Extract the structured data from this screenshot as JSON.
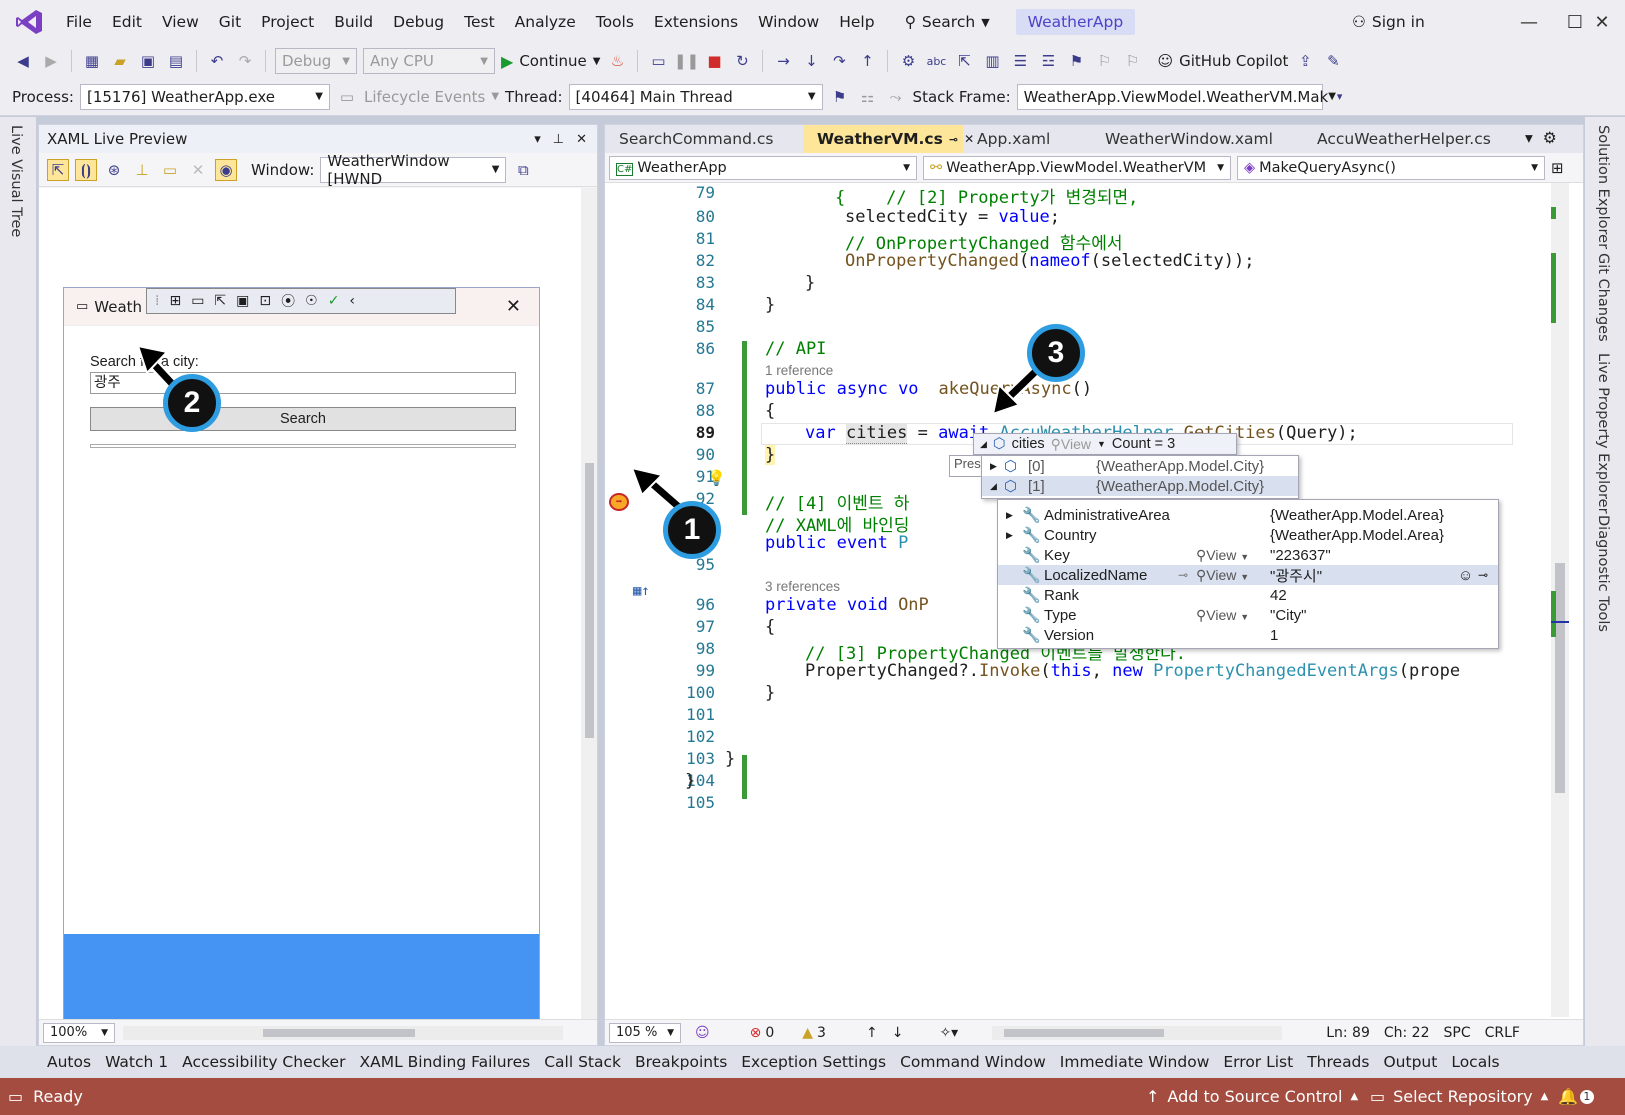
{
  "menu": [
    "File",
    "Edit",
    "View",
    "Git",
    "Project",
    "Build",
    "Debug",
    "Test",
    "Analyze",
    "Tools",
    "Extensions",
    "Window",
    "Help"
  ],
  "search_label": "Search",
  "solution_name": "WeatherApp",
  "sign_in": "Sign in",
  "toolbar": {
    "config": "Debug",
    "platform": "Any CPU",
    "continue_label": "Continue",
    "copilot": "GitHub Copilot"
  },
  "debugbar": {
    "process_label": "Process:",
    "process_value": "[15176] WeatherApp.exe",
    "lifecycle": "Lifecycle Events",
    "thread_label": "Thread:",
    "thread_value": "[40464] Main Thread",
    "stackframe_label": "Stack Frame:",
    "stackframe_value": "WeatherApp.ViewModel.WeatherVM.Mak"
  },
  "left_strip": "Live Visual Tree",
  "xaml": {
    "title": "XAML Live Preview",
    "window_label": "Window:",
    "window_value": "WeatherWindow [HWND",
    "zoom": "100%",
    "wpf_title": "Weath",
    "search_prompt": "Search for a city:",
    "search_value": "광주",
    "search_button": "Search"
  },
  "tabs": [
    "SearchCommand.cs",
    "WeatherVM.cs",
    "App.xaml",
    "WeatherWindow.xaml",
    "AccuWeatherHelper.cs"
  ],
  "nav": {
    "project": "WeatherApp",
    "class": "WeatherApp.ViewModel.WeatherVM",
    "member": "MakeQueryAsync()"
  },
  "code": {
    "line_numbers": [
      "79",
      "80",
      "81",
      "82",
      "83",
      "84",
      "85",
      "86",
      "87",
      "88",
      "89",
      "90",
      "91",
      "92",
      "93",
      "94",
      "95",
      "96",
      "97",
      "98",
      "99",
      "100",
      "101",
      "102",
      "103",
      "104",
      "105"
    ],
    "l79": "{    // [2] Property가 변경되면,",
    "l80a": "selectedCity = ",
    "l80b": "value",
    "l80c": ";",
    "l81": "// OnPropertyChanged 함수에서",
    "l82a": "OnPropertyChanged",
    "l82b": "(",
    "l82c": "nameof",
    "l82d": "(selectedCity));",
    "l83": "}",
    "l84": "}",
    "l86": "// API",
    "ref1": "1 reference",
    "l87a": "public async ",
    "l87b": "vo",
    "l87c": "akeQueryAsync",
    "l87d": "()",
    "l88": "{",
    "l89a": "var ",
    "l89b": "cities",
    "l89c": " = ",
    "l89d": "await ",
    "l89e": "AccuWeatherHelper",
    "l89f": ".",
    "l89g": "GetCities",
    "l89h": "(Query);",
    "l90": "}",
    "l92": "// [4] 이벤트 하",
    "l93": "// XAML에 바인딩",
    "l93end": ".",
    "l94a": "public event ",
    "l94b": "P",
    "ref3": "3 references",
    "l96a": "private void ",
    "l96b": "OnP",
    "l97": "{",
    "l98": "// [3] PropertyChanged 이벤트를 발생한다.",
    "l99a": "PropertyChanged?.",
    "l99b": "Invoke",
    "l99c": "(",
    "l99d": "this",
    "l99e": ", ",
    "l99f": "new ",
    "l99g": "PropertyChangedEventArgs",
    "l99h": "(prope",
    "l100": "}",
    "l103": "}",
    "l104": "}"
  },
  "datatip": {
    "var": "cities",
    "view": "View",
    "count": "Count = 3",
    "press": "Pres",
    "items": [
      {
        "index": "[0]",
        "value": "{WeatherApp.Model.City}"
      },
      {
        "index": "[1]",
        "value": "{WeatherApp.Model.City}"
      }
    ],
    "props": [
      {
        "name": "AdministrativeArea",
        "value": "{WeatherApp.Model.Area}",
        "view": ""
      },
      {
        "name": "Country",
        "value": "{WeatherApp.Model.Area}",
        "view": ""
      },
      {
        "name": "Key",
        "value": "\"223637\"",
        "view": "View"
      },
      {
        "name": "LocalizedName",
        "value": "\"광주시\"",
        "view": "View"
      },
      {
        "name": "Rank",
        "value": "42",
        "view": ""
      },
      {
        "name": "Type",
        "value": "\"City\"",
        "view": "View"
      },
      {
        "name": "Version",
        "value": "1",
        "view": ""
      }
    ]
  },
  "editor_status": {
    "zoom": "105 %",
    "errors": "0",
    "warnings": "3",
    "ln": "Ln: 89",
    "ch": "Ch: 22",
    "spc": "SPC",
    "crlf": "CRLF"
  },
  "right_strip": [
    "Solution Explorer",
    "Git Changes",
    "Live Property Explorer",
    "Diagnostic Tools"
  ],
  "bottom_tabs": [
    "Autos",
    "Watch 1",
    "Accessibility Checker",
    "XAML Binding Failures",
    "Call Stack",
    "Breakpoints",
    "Exception Settings",
    "Command Window",
    "Immediate Window",
    "Error List",
    "Threads",
    "Output",
    "Locals"
  ],
  "status": {
    "ready": "Ready",
    "source_control": "Add to Source Control",
    "repository": "Select Repository",
    "notifications": "1"
  },
  "callouts": [
    "1",
    "2",
    "3"
  ],
  "colors": {
    "accent": "#2d9ce0",
    "status_bar": "#a54c40",
    "active_tab": "#fde69a",
    "wpf_blue": "#4593f2"
  }
}
